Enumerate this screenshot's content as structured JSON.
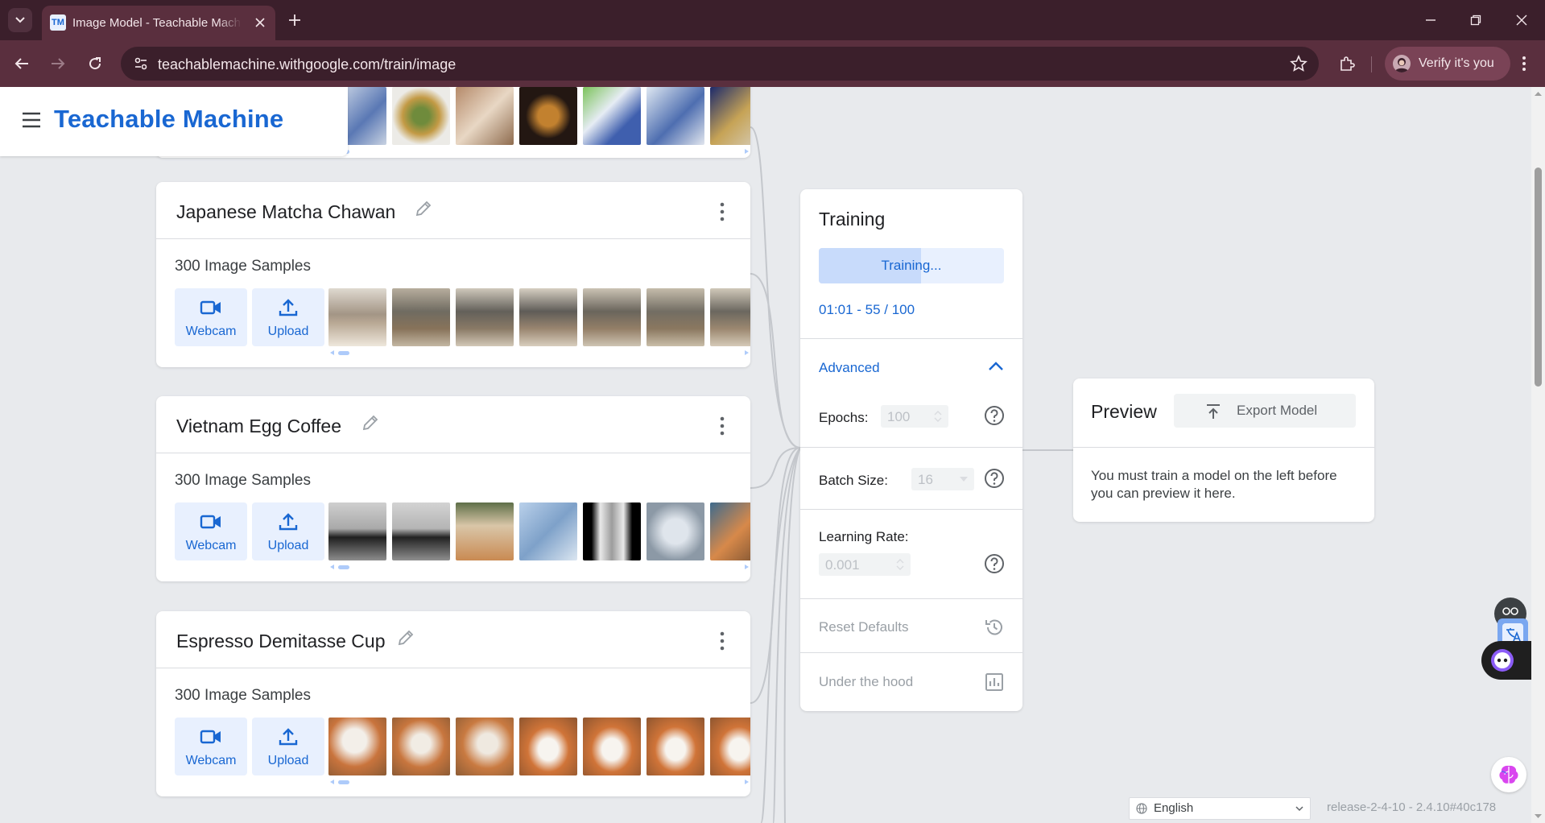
{
  "browser": {
    "tab_title": "Image Model - Teachable Machine",
    "favicon_text": "TM",
    "url": "teachablemachine.withgoogle.com/train/image",
    "profile_label": "Verify it's you"
  },
  "app": {
    "brand": "Teachable Machine"
  },
  "classes": [
    {
      "title": "Japanese Matcha Chawan",
      "samples": "300 Image Samples",
      "webcam_label": "Webcam",
      "upload_label": "Upload"
    },
    {
      "title": "Vietnam Egg Coffee",
      "samples": "300 Image Samples",
      "webcam_label": "Webcam",
      "upload_label": "Upload"
    },
    {
      "title": "Espresso Demitasse Cup",
      "samples": "300 Image Samples",
      "webcam_label": "Webcam",
      "upload_label": "Upload"
    }
  ],
  "training": {
    "title": "Training",
    "button_label": "Training...",
    "progress_fraction": 0.55,
    "progress_text": "01:01 - 55 / 100",
    "advanced_label": "Advanced",
    "epochs_label": "Epochs:",
    "epochs_value": "100",
    "batch_label": "Batch Size:",
    "batch_value": "16",
    "lr_label": "Learning Rate:",
    "lr_value": "0.001",
    "reset_label": "Reset Defaults",
    "hood_label": "Under the hood"
  },
  "preview": {
    "title": "Preview",
    "export_label": "Export Model",
    "message": "You must train a model on the left before you can preview it here."
  },
  "footer": {
    "language": "English",
    "release": "release-2-4-10 - 2.4.10#40c178"
  },
  "colors": {
    "accent": "#1967d2",
    "accent_light": "#e8f0fe",
    "chrome_dark": "#3b1f2b",
    "chrome_mid": "#5a2f3e"
  }
}
